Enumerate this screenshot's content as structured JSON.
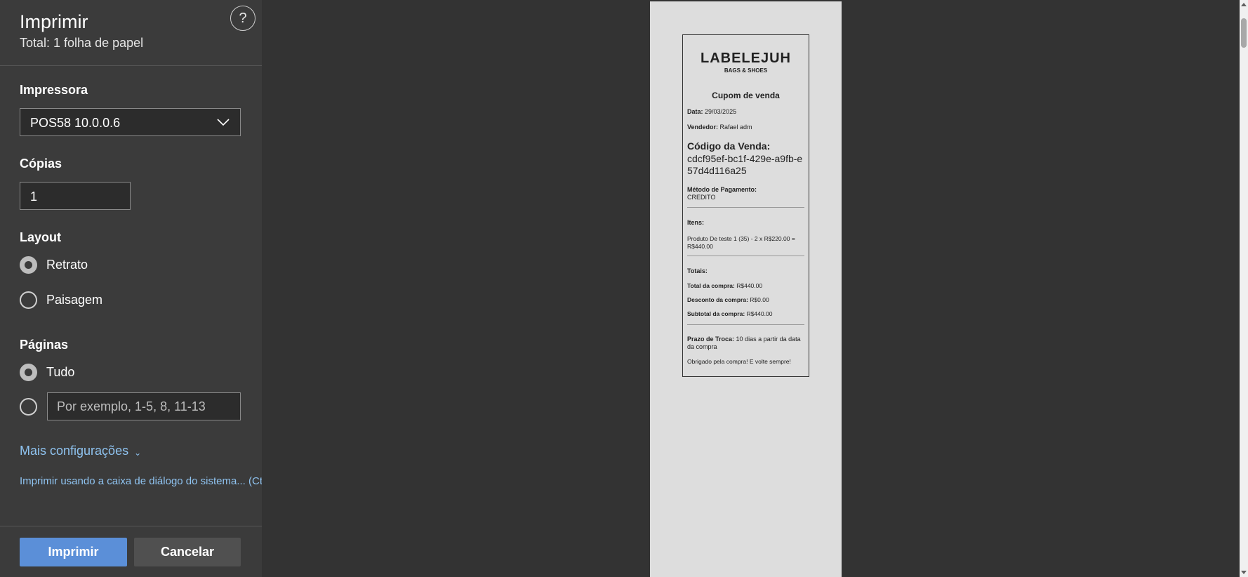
{
  "dialog": {
    "title": "Imprimir",
    "total": "Total: 1 folha de papel",
    "help_symbol": "?"
  },
  "printer": {
    "label": "Impressora",
    "selected": "POS58 10.0.0.6"
  },
  "copies": {
    "label": "Cópias",
    "value": "1"
  },
  "layout": {
    "label": "Layout",
    "options": [
      {
        "label": "Retrato",
        "selected": true
      },
      {
        "label": "Paisagem",
        "selected": false
      }
    ]
  },
  "pages": {
    "label": "Páginas",
    "all_label": "Tudo",
    "custom_placeholder": "Por exemplo, 1-5, 8, 11-13"
  },
  "more_settings": "Mais configurações",
  "system_dialog": "Imprimir usando a caixa de diálogo do sistema... (Ctr",
  "buttons": {
    "print": "Imprimir",
    "cancel": "Cancelar"
  },
  "receipt": {
    "brand": "LABELEJUH",
    "brand_sub": "BAGS & SHOES",
    "heading": "Cupom de venda",
    "date_label": "Data:",
    "date": "29/03/2025",
    "seller_label": "Vendedor:",
    "seller": "Rafael adm",
    "code_label": "Código da Venda:",
    "code": "cdcf95ef-bc1f-429e-a9fb-e57d4d116a25",
    "payment_label": "Método de Pagamento:",
    "payment": "CREDITO",
    "items_label": "Itens:",
    "item_line": "Produto De teste 1 (35) - 2 x R$220.00 = R$440.00",
    "totals_label": "Totais:",
    "total_label": "Total da compra:",
    "total": "R$440.00",
    "discount_label": "Desconto da compra:",
    "discount": "R$0.00",
    "subtotal_label": "Subtotal da compra:",
    "subtotal": "R$440.00",
    "exchange_label": "Prazo de Troca:",
    "exchange": "10 dias a partir da data da compra",
    "thanks": "Obrigado pela compra! E volte sempre!"
  },
  "colors": {
    "panel_bg": "#3b3b3b",
    "preview_bg": "#333333",
    "primary_button": "#5b8fd8",
    "link": "#8fc3f0"
  }
}
